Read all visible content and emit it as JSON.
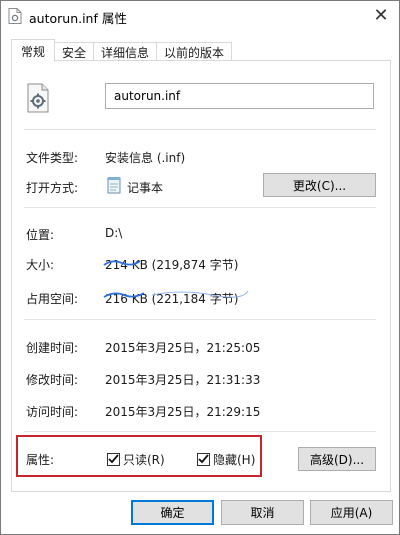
{
  "window": {
    "title": "autorun.inf 属性",
    "close_glyph": "✕"
  },
  "tabs": [
    {
      "label": "常规"
    },
    {
      "label": "安全"
    },
    {
      "label": "详细信息"
    },
    {
      "label": "以前的版本"
    }
  ],
  "general": {
    "file_name": "autorun.inf",
    "file_type_label": "文件类型:",
    "file_type_value": "安装信息 (.inf)",
    "open_with_label": "打开方式:",
    "open_with_value": "记事本",
    "change_button": "更改(C)...",
    "location_label": "位置:",
    "location_value": "D:\\",
    "size_label": "大小:",
    "size_value": "214 KB (219,874 字节)",
    "size_on_disk_label": "占用空间:",
    "size_on_disk_value": "216 KB (221,184 字节)",
    "created_label": "创建时间:",
    "created_value": "2015年3月25日，21:25:05",
    "modified_label": "修改时间:",
    "modified_value": "2015年3月25日，21:31:33",
    "accessed_label": "访问时间:",
    "accessed_value": "2015年3月25日，21:29:15",
    "attributes_label": "属性:",
    "readonly_label": "只读(R)",
    "readonly_checked": true,
    "hidden_label": "隐藏(H)",
    "hidden_checked": true,
    "advanced_button": "高级(D)..."
  },
  "footer": {
    "ok": "确定",
    "cancel": "取消",
    "apply": "应用(A)"
  },
  "colors": {
    "highlight_box": "#c8242e",
    "primary_border": "#0078d7",
    "scribble": "#2a6fdb"
  }
}
